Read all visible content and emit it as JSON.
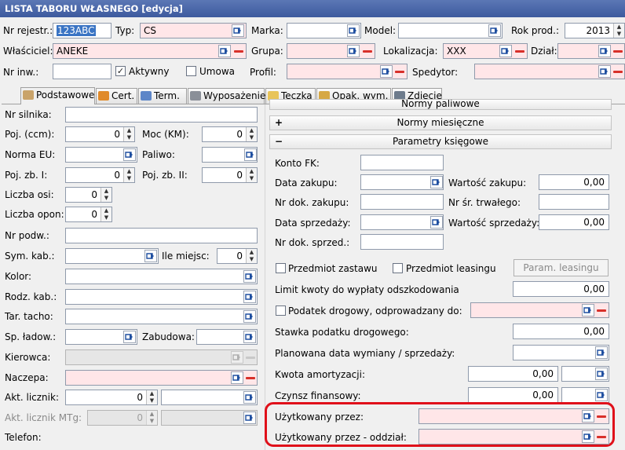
{
  "window": {
    "title": "LISTA TABORU WŁASNEGO [edycja]"
  },
  "header": {
    "nr_rejestr_label": "Nr rejestr.:",
    "nr_rejestr_value": "123ABC",
    "typ_label": "Typ:",
    "typ_value": "CS",
    "marka_label": "Marka:",
    "marka_value": "",
    "model_label": "Model:",
    "model_value": "",
    "rok_prod_label": "Rok prod.:",
    "rok_prod_value": "2013",
    "wlasciciel_label": "Właściciel:",
    "wlasciciel_value": "ANEKE",
    "grupa_label": "Grupa:",
    "grupa_value": "",
    "lokalizacja_label": "Lokalizacja:",
    "lokalizacja_value": "XXX",
    "dzial_label": "Dział:",
    "dzial_value": "",
    "nr_inw_label": "Nr inw.:",
    "nr_inw_value": "",
    "aktywny_label": "Aktywny",
    "aktywny_checked": true,
    "umowa_label": "Umowa",
    "umowa_checked": false,
    "profil_label": "Profil:",
    "profil_value": "",
    "spedytor_label": "Spedytor:",
    "spedytor_value": ""
  },
  "tabs": [
    {
      "label": "Podstawowe",
      "icon": "card-icon"
    },
    {
      "label": "Cert.",
      "icon": "certificate-icon"
    },
    {
      "label": "Term.",
      "icon": "calendar-icon"
    },
    {
      "label": "Wyposażenie",
      "icon": "wrench-icon"
    },
    {
      "label": "Teczka",
      "icon": "folder-icon"
    },
    {
      "label": "Opak. wym.",
      "icon": "package-icon"
    },
    {
      "label": "Zdjęcie",
      "icon": "camera-icon"
    }
  ],
  "left": {
    "nr_silnika_label": "Nr silnika:",
    "nr_silnika_value": "",
    "poj_label": "Poj. (ccm):",
    "poj_value": "0",
    "moc_label": "Moc (KM):",
    "moc_value": "0",
    "norma_eu_label": "Norma EU:",
    "norma_eu_value": "",
    "paliwo_label": "Paliwo:",
    "paliwo_value": "",
    "poj_zb1_label": "Poj. zb. I:",
    "poj_zb1_value": "0",
    "poj_zb2_label": "Poj. zb. II:",
    "poj_zb2_value": "0",
    "liczba_osi_label": "Liczba osi:",
    "liczba_osi_value": "0",
    "liczba_opon_label": "Liczba opon:",
    "liczba_opon_value": "0",
    "nr_podw_label": "Nr podw.:",
    "nr_podw_value": "",
    "sym_kab_label": "Sym. kab.:",
    "sym_kab_value": "",
    "ile_miejsc_label": "Ile miejsc:",
    "ile_miejsc_value": "0",
    "kolor_label": "Kolor:",
    "kolor_value": "",
    "rodz_kab_label": "Rodz. kab.:",
    "rodz_kab_value": "",
    "tar_tacho_label": "Tar. tacho:",
    "tar_tacho_value": "",
    "sp_ladow_label": "Sp. ładow.:",
    "sp_ladow_value": "",
    "zabudowa_label": "Zabudowa:",
    "zabudowa_value": "",
    "kierowca_label": "Kierowca:",
    "kierowca_value": "",
    "naczepa_label": "Naczepa:",
    "naczepa_value": "",
    "akt_licznik_label": "Akt. licznik:",
    "akt_licznik_value": "0",
    "akt_licznik_unit": "",
    "akt_licznik_mtg_label": "Akt. licznik MTg:",
    "akt_licznik_mtg_value": "0",
    "akt_licznik_mtg_unit": "",
    "telefon_label": "Telefon:"
  },
  "right": {
    "norms_paliwowe_label": "Normy paliwowe",
    "norms_miesieczne_label": "Normy miesięczne",
    "parametry_ksiegowe_label": "Parametry księgowe",
    "konto_fk_label": "Konto FK:",
    "konto_fk_value": "",
    "data_zakupu_label": "Data zakupu:",
    "data_zakupu_value": "",
    "wartosc_zakupu_label": "Wartość zakupu:",
    "wartosc_zakupu_value": "0,00",
    "nr_dok_zakupu_label": "Nr dok. zakupu:",
    "nr_dok_zakupu_value": "",
    "nr_sr_trwalego_label": "Nr śr. trwałego:",
    "nr_sr_trwalego_value": "",
    "data_sprzedazy_label": "Data sprzedaży:",
    "data_sprzedazy_value": "",
    "wartosc_sprzedazy_label": "Wartość sprzedaży:",
    "wartosc_sprzedazy_value": "0,00",
    "nr_dok_sprzed_label": "Nr dok. sprzed.:",
    "nr_dok_sprzed_value": "",
    "przedmiot_zastawu_label": "Przedmiot zastawu",
    "przedmiot_leasingu_label": "Przedmiot leasingu",
    "param_leasingu_label": "Param. leasingu",
    "limit_kwoty_label": "Limit kwoty do wypłaty odszkodowania",
    "limit_kwoty_value": "0,00",
    "podatek_drogowy_label": "Podatek drogowy, odprowadzany do:",
    "podatek_drogowy_value": "",
    "stawka_podatku_label": "Stawka podatku drogowego:",
    "stawka_podatku_value": "0,00",
    "planowana_data_label": "Planowana data wymiany / sprzedaży:",
    "planowana_data_value": "",
    "kwota_amortyzacji_label": "Kwota amortyzacji:",
    "kwota_amortyzacji_value": "0,00",
    "kwota_amortyzacji_unit": "",
    "czynsz_finansowy_label": "Czynsz finansowy:",
    "czynsz_finansowy_value": "0,00",
    "czynsz_finansowy_unit": "",
    "uzytkowany_przez_label": "Użytkowany przez:",
    "uzytkowany_przez_value": "",
    "uzytkowany_oddzial_label": "Użytkowany przez - oddział:",
    "uzytkowany_oddzial_value": ""
  },
  "colors": {
    "required_field": "#ffe6e8",
    "highlight_box": "#e0101a",
    "title_bar": "#4a67aa"
  }
}
